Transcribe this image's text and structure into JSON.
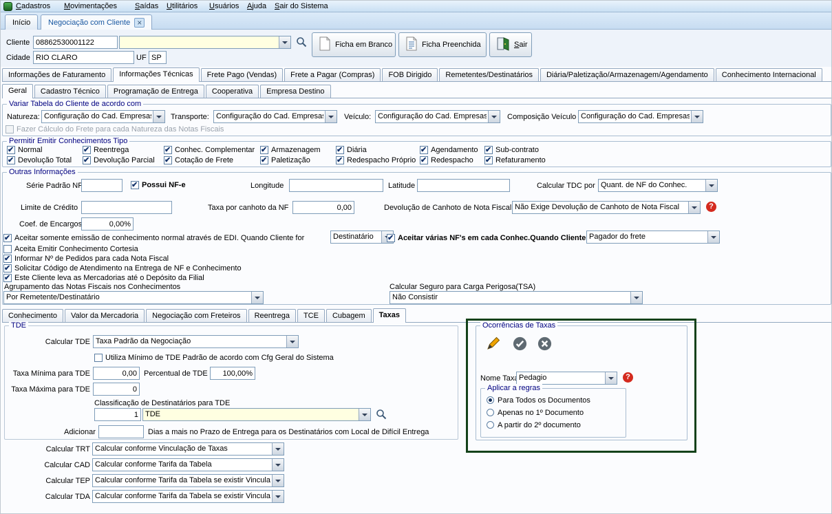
{
  "colors": {
    "label_navy": "#000080",
    "field_yellow": "#ffffe1",
    "help_red": "#d42a1e",
    "highlight_green": "#14421a",
    "active_tab_blue": "#1857a0"
  },
  "menubar": {
    "items": [
      "Cadastros",
      "Movimentações",
      "Saídas",
      "Utilitários",
      "Usuários",
      "Ajuda",
      "Sair do Sistema"
    ]
  },
  "window_tabs": {
    "inicio": "Início",
    "active": "Negociação com Cliente"
  },
  "client_header": {
    "cliente_label": "Cliente",
    "cliente_code": "08862530001122",
    "cliente_name": "",
    "cidade_label": "Cidade",
    "cidade_value": "RIO CLARO",
    "uf_label": "UF",
    "uf_value": "SP",
    "ficha_branco": "Ficha em Branco",
    "ficha_preenchida": "Ficha Preenchida",
    "sair": "Sair"
  },
  "main_tabs": [
    "Informações de Faturamento",
    "Informações Técnicas",
    "Frete Pago (Vendas)",
    "Frete a Pagar (Compras)",
    "FOB Dirigido",
    "Remetentes/Destinatários",
    "Diária/Paletização/Armazenagem/Agendamento",
    "Conhecimento Internacional"
  ],
  "sub_tabs": [
    "Geral",
    "Cadastro Técnico",
    "Programação de Entrega",
    "Cooperativa",
    "Empresa Destino"
  ],
  "variar_tabela": {
    "title": "Variar Tabela do Cliente de acordo com",
    "natureza_label": "Natureza:",
    "natureza_value": "Configuração do Cad. Empresas",
    "transporte_label": "Transporte:",
    "transporte_value": "Configuração do Cad. Empresas",
    "veiculo_label": "Veículo:",
    "veiculo_value": "Configuração do Cad. Empresas",
    "composicao_label": "Composição Veículo",
    "composicao_value": "Configuração do Cad. Empresas",
    "calc_frete_natureza": "Fazer Cálculo do Frete para cada Natureza das Notas Fiscais"
  },
  "conhecimentos_tipo": {
    "title": "Permitir Emitir Conhecimentos Tipo",
    "row1": [
      "Normal",
      "Reentrega",
      "Conhec. Complementar",
      "Armazenagem",
      "Diária",
      "Agendamento",
      "Sub-contrato"
    ],
    "row2": [
      "Devolução Total",
      "Devolução Parcial",
      "Cotação de Frete",
      "Paletização",
      "Redespacho Próprio",
      "Redespacho",
      "Refaturamento"
    ]
  },
  "outras_informacoes": {
    "title": "Outras Informações",
    "serie_padrao_label": "Série Padrão NF",
    "serie_padrao_value": "",
    "possui_nfe": "Possui NF-e",
    "longitude_label": "Longitude",
    "longitude_value": "",
    "latitude_label": "Latitude",
    "latitude_value": "",
    "calcular_tdc_label": "Calcular TDC por",
    "calcular_tdc_value": "Quant. de NF do Conhec.",
    "limite_credito_label": "Limite de Crédito",
    "limite_credito_value": "",
    "taxa_canhoto_label": "Taxa por canhoto da NF",
    "taxa_canhoto_value": "0,00",
    "devolucao_canhoto_label": "Devolução de Canhoto de Nota Fiscal",
    "devolucao_canhoto_value": "Não Exige Devolução de Canhoto de Nota Fiscal",
    "coef_encargos_label": "Coef. de Encargos",
    "coef_encargos_value": "0,00%",
    "aceitar_edi_label": "Aceitar somente emissão de conhecimento normal através de EDI. Quando Cliente for",
    "aceitar_edi_value": "Destinatário",
    "aceitar_varias_label": "Aceitar várias NF's em cada Conhec.Quando Cliente for",
    "aceitar_varias_value": "Pagador do frete",
    "cortesia": "Aceita Emitir Conhecimento Cortesia",
    "informar_pedidos": "Informar Nº de Pedidos para cada Nota Fiscal",
    "solicitar_codigo": "Solicitar Código de Atendimento na Entrega de NF e Conhecimento",
    "cliente_leva": "Este Cliente leva as Mercadorias até o Depósito da Filial",
    "agrupamento_label": "Agrupamento das Notas Fiscais nos Conhecimentos",
    "agrupamento_value": "Por Remetente/Destinatário",
    "seguro_label": "Calcular Seguro para Carga Perigosa(TSA)",
    "seguro_value": "Não Consistir"
  },
  "lower_tabs": [
    "Conhecimento",
    "Valor da Mercadoria",
    "Negociação com Freteiros",
    "Reentrega",
    "TCE",
    "Cubagem",
    "Taxas"
  ],
  "tde": {
    "title": "TDE",
    "calcular_tde_label": "Calcular TDE",
    "calcular_tde_value": "Taxa Padrão da Negociação",
    "utiliza_minimo": "Utiliza Mínimo de TDE Padrão de acordo com Cfg Geral do Sistema",
    "taxa_minima_label": "Taxa Mínima para TDE",
    "taxa_minima_value": "0,00",
    "percentual_label": "Percentual de TDE",
    "percentual_value": "100,00%",
    "taxa_maxima_label": "Taxa Máxima para TDE",
    "taxa_maxima_value": "0",
    "classificacao_label": "Classificação de Destinatários para TDE",
    "classificacao_num": "1",
    "classificacao_value": "TDE",
    "adicionar_label": "Adicionar",
    "adicionar_value": "",
    "adicionar_text": "Dias  a mais no Prazo de Entrega para os Destinatários com Local de Difícil Entrega"
  },
  "calculos": {
    "trt_label": "Calcular TRT",
    "trt_value": "Calcular conforme Vinculação de Taxas",
    "cad_label": "Calcular CAD",
    "cad_value": "Calcular conforme Tarifa da Tabela",
    "tep_label": "Calcular TEP",
    "tep_value": "Calcular conforme Tarifa da Tabela se existir Vincula",
    "tda_label": "Calcular TDA",
    "tda_value": "Calcular conforme Tarifa da Tabela se existir Vincula"
  },
  "ocorrencias": {
    "title": "Ocorrências de Taxas",
    "nome_taxa_label": "Nome Taxa",
    "nome_taxa_value": "Pedagio",
    "aplicar_title": "Aplicar a regras",
    "options": [
      "Para Todos os Documentos",
      "Apenas no 1º Documento",
      "A partir do 2º documento"
    ]
  }
}
